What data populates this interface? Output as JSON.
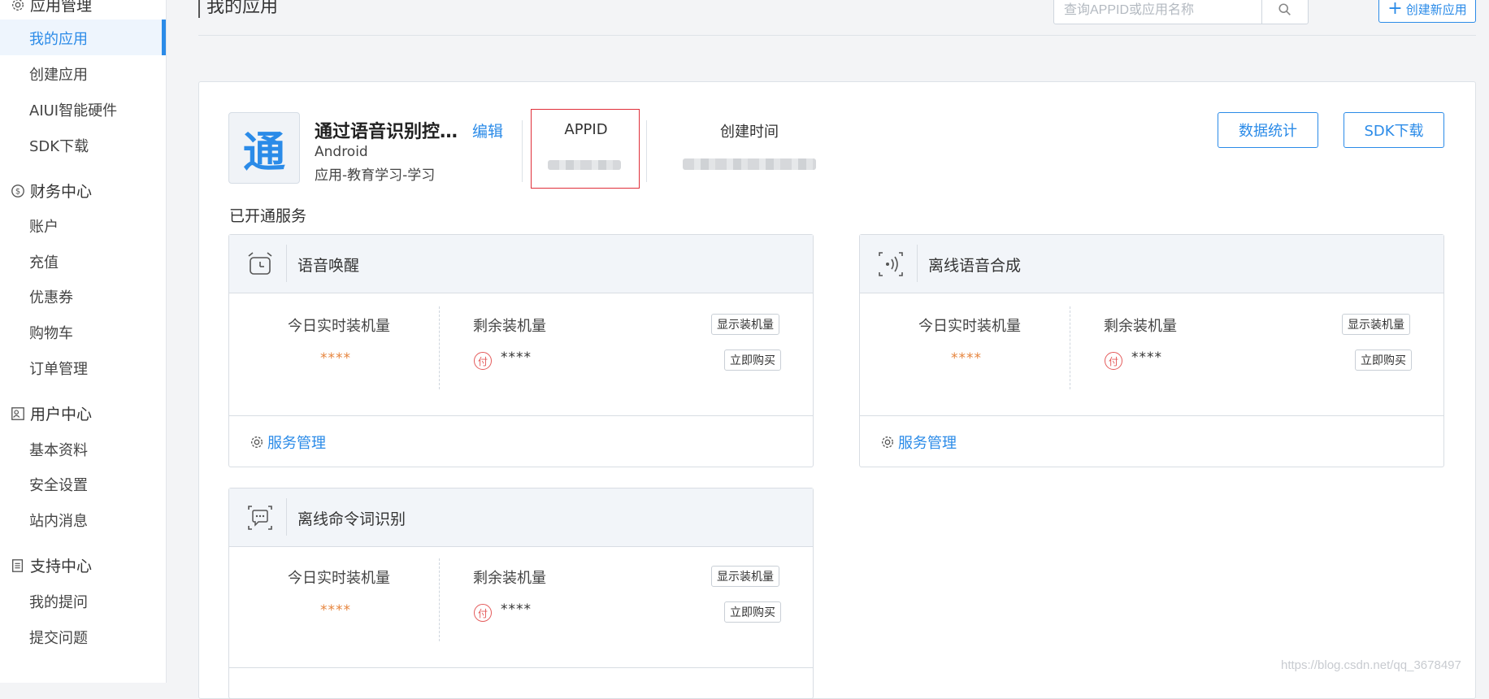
{
  "sidebar": {
    "groups": [
      {
        "label": "应用管理",
        "icon": "gear-icon",
        "items": [
          {
            "label": "我的应用",
            "active": true
          },
          {
            "label": "创建应用"
          },
          {
            "label": "AIUI智能硬件"
          },
          {
            "label": "SDK下载"
          }
        ]
      },
      {
        "label": "财务中心",
        "icon": "coin-icon",
        "items": [
          {
            "label": "账户"
          },
          {
            "label": "充值"
          },
          {
            "label": "优惠券"
          },
          {
            "label": "购物车"
          },
          {
            "label": "订单管理"
          }
        ]
      },
      {
        "label": "用户中心",
        "icon": "user-card-icon",
        "items": [
          {
            "label": "基本资料"
          },
          {
            "label": "安全设置"
          },
          {
            "label": "站内消息"
          }
        ]
      },
      {
        "label": "支持中心",
        "icon": "document-icon",
        "items": [
          {
            "label": "我的提问"
          },
          {
            "label": "提交问题"
          }
        ]
      }
    ]
  },
  "header": {
    "title": "我的应用",
    "search_placeholder": "查询APPID或应用名称",
    "create_label": "创建新应用"
  },
  "app": {
    "icon_char": "通",
    "name": "通过语音识别控…",
    "edit_label": "编辑",
    "platform": "Android",
    "category": "应用-教育学习-学习",
    "appid_label": "APPID",
    "created_label": "创建时间",
    "stats_button": "数据统计",
    "sdk_button": "SDK下载"
  },
  "services_title": "已开通服务",
  "services": [
    {
      "title": "语音唤醒",
      "icon": "alarm-clock-icon",
      "today_label": "今日实时装机量",
      "today_value": "****",
      "remain_label": "剩余装机量",
      "remain_value": "****",
      "pay_badge": "付",
      "show_button": "显示装机量",
      "buy_button": "立即购买",
      "manage_label": "服务管理"
    },
    {
      "title": "离线语音合成",
      "icon": "voice-wave-icon",
      "today_label": "今日实时装机量",
      "today_value": "****",
      "remain_label": "剩余装机量",
      "remain_value": "****",
      "pay_badge": "付",
      "show_button": "显示装机量",
      "buy_button": "立即购买",
      "manage_label": "服务管理"
    },
    {
      "title": "离线命令词识别",
      "icon": "chat-bubble-icon",
      "today_label": "今日实时装机量",
      "today_value": "****",
      "remain_label": "剩余装机量",
      "remain_value": "****",
      "pay_badge": "付",
      "show_button": "显示装机量",
      "buy_button": "立即购买"
    }
  ],
  "colors": {
    "accent": "#2b8be8",
    "orange": "#e6843d",
    "red": "#e0303a"
  },
  "watermark": "https://blog.csdn.net/qq_3678497"
}
